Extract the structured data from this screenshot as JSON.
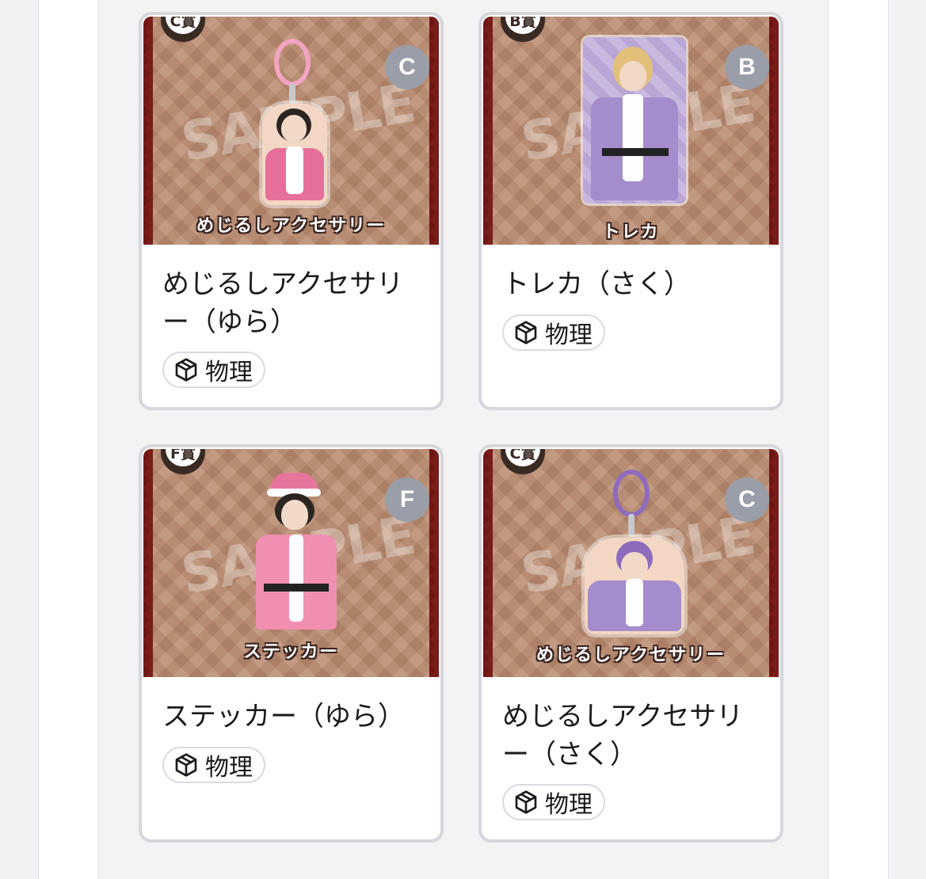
{
  "cards": [
    {
      "title": "めじるしアクセサリー（ゆら）",
      "tag": "物理",
      "grade": "C",
      "prize_badge": "C賞",
      "caption": "めじるしアクセサリー",
      "watermark": "SAMPLE"
    },
    {
      "title": "トレカ（さく）",
      "tag": "物理",
      "grade": "B",
      "prize_badge": "B賞",
      "caption": "トレカ",
      "watermark": "SAMPLE"
    },
    {
      "title": "ステッカー（ゆら）",
      "tag": "物理",
      "grade": "F",
      "prize_badge": "F賞",
      "caption": "ステッカー",
      "watermark": "SAMPLE"
    },
    {
      "title": "めじるしアクセサリー（さく）",
      "tag": "物理",
      "grade": "C",
      "prize_badge": "C賞",
      "caption": "めじるしアクセサリー",
      "watermark": "SAMPLE"
    }
  ],
  "icons": {
    "tag_icon": "package-icon"
  },
  "colors": {
    "card_border": "#d6d7dc",
    "grade_bg": "#9a9ea8",
    "thumb_bg": "#b98a6e"
  }
}
